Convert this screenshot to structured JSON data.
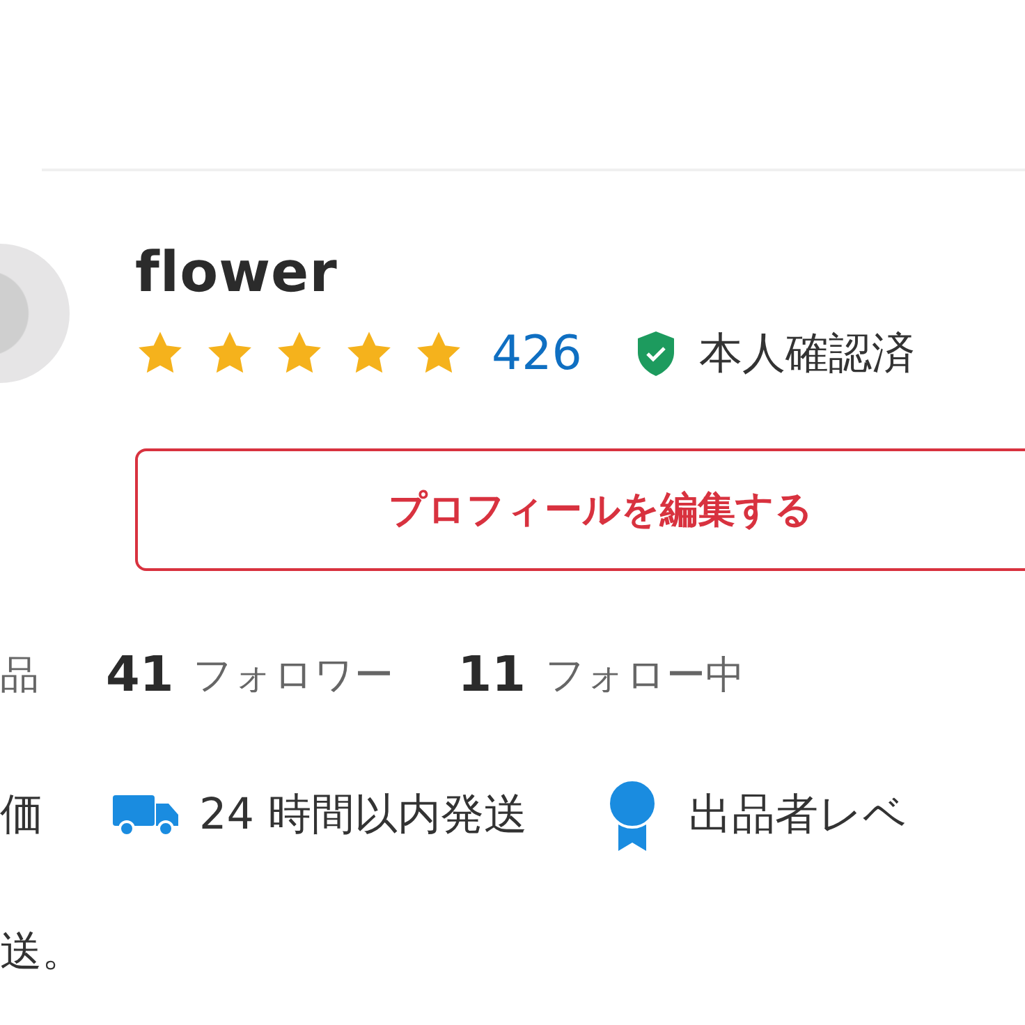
{
  "profile": {
    "name": "flower",
    "stars": 5,
    "rating_count": "426",
    "verified": true,
    "verified_label": "本人確認済"
  },
  "edit_button": {
    "label": "プロフィールを編集する"
  },
  "stats": [
    {
      "label": "品"
    },
    {
      "count": "41",
      "label": "フォロワー"
    },
    {
      "count": "11",
      "label": "フォロー中"
    }
  ],
  "badges": [
    {
      "kind": "text",
      "label": "価"
    },
    {
      "kind": "shipping",
      "label": "24 時間以内発送"
    },
    {
      "kind": "level",
      "label": "出品者レベ"
    }
  ],
  "bio": "送。"
}
